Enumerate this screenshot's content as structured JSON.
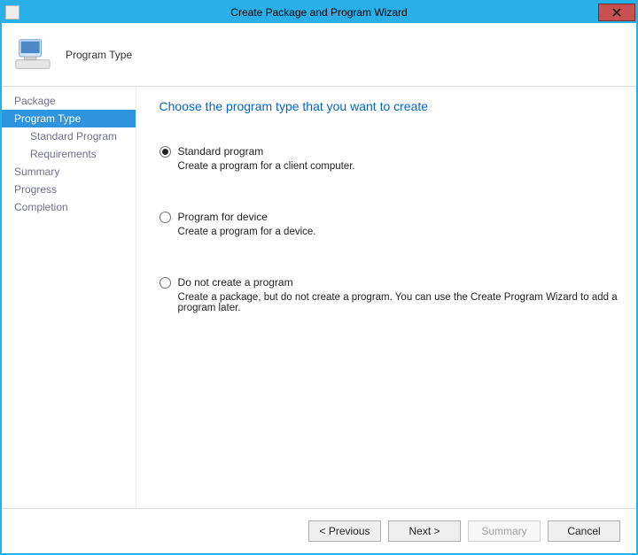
{
  "window": {
    "title": "Create Package and Program Wizard"
  },
  "header": {
    "title": "Program Type"
  },
  "sidebar": {
    "items": [
      {
        "label": "Package",
        "selected": false,
        "sub": false
      },
      {
        "label": "Program Type",
        "selected": true,
        "sub": false
      },
      {
        "label": "Standard Program",
        "selected": false,
        "sub": true
      },
      {
        "label": "Requirements",
        "selected": false,
        "sub": true
      },
      {
        "label": "Summary",
        "selected": false,
        "sub": false
      },
      {
        "label": "Progress",
        "selected": false,
        "sub": false
      },
      {
        "label": "Completion",
        "selected": false,
        "sub": false
      }
    ]
  },
  "content": {
    "heading": "Choose the program type that you want to create",
    "options": [
      {
        "id": "standard",
        "label": "Standard program",
        "description": "Create a program for a client computer.",
        "checked": true
      },
      {
        "id": "device",
        "label": "Program for device",
        "description": "Create a program for a device.",
        "checked": false
      },
      {
        "id": "none",
        "label": "Do not create a program",
        "description": "Create a package, but do not create a program. You can use the Create Program Wizard to add a program later.",
        "checked": false
      }
    ]
  },
  "footer": {
    "previous": "< Previous",
    "next": "Next >",
    "summary": "Summary",
    "cancel": "Cancel"
  }
}
